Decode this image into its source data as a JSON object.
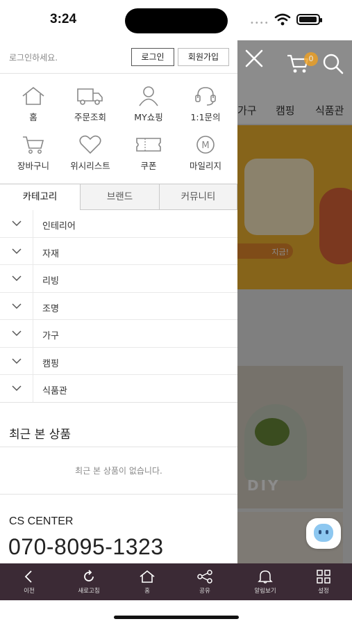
{
  "status": {
    "time": "3:24"
  },
  "drawer": {
    "login_prompt": "로그인하세요.",
    "login_button": "로그인",
    "signup_button": "회원가입",
    "quick_menu": [
      {
        "label": "홈",
        "icon": "home-icon"
      },
      {
        "label": "주문조회",
        "icon": "truck-icon"
      },
      {
        "label": "MY쇼핑",
        "icon": "user-icon"
      },
      {
        "label": "1:1문의",
        "icon": "headset-icon"
      },
      {
        "label": "장바구니",
        "icon": "cart-icon"
      },
      {
        "label": "위시리스트",
        "icon": "heart-icon"
      },
      {
        "label": "쿠폰",
        "icon": "coupon-icon"
      },
      {
        "label": "마일리지",
        "icon": "mileage-icon",
        "badge": "M"
      }
    ],
    "tabs": [
      {
        "label": "카테고리",
        "active": true
      },
      {
        "label": "브랜드",
        "active": false
      },
      {
        "label": "커뮤니티",
        "active": false
      }
    ],
    "categories": [
      "인테리어",
      "자재",
      "리빙",
      "조명",
      "가구",
      "캠핑",
      "식품관"
    ],
    "recent": {
      "title": "최근 본 상품",
      "empty": "최근 본 상품이 없습니다."
    },
    "cs": {
      "title": "CS CENTER",
      "phone": "070-8095-1323"
    }
  },
  "background": {
    "cart_count": "0",
    "categories": [
      "가구",
      "캠핑",
      "식품관"
    ],
    "banner_tag": "지금!",
    "photo_text": "DIY"
  },
  "bottom_nav": [
    {
      "label": "이전",
      "icon": "back-icon"
    },
    {
      "label": "새로고침",
      "icon": "refresh-icon"
    },
    {
      "label": "홈",
      "icon": "home-icon"
    },
    {
      "label": "공유",
      "icon": "share-icon"
    },
    {
      "label": "알림보기",
      "icon": "bell-icon"
    },
    {
      "label": "설정",
      "icon": "grid-icon"
    }
  ],
  "colors": {
    "bottom_nav_bg": "#3b2a35",
    "banner": "#f4b731",
    "cart_badge": "#f0a020"
  }
}
